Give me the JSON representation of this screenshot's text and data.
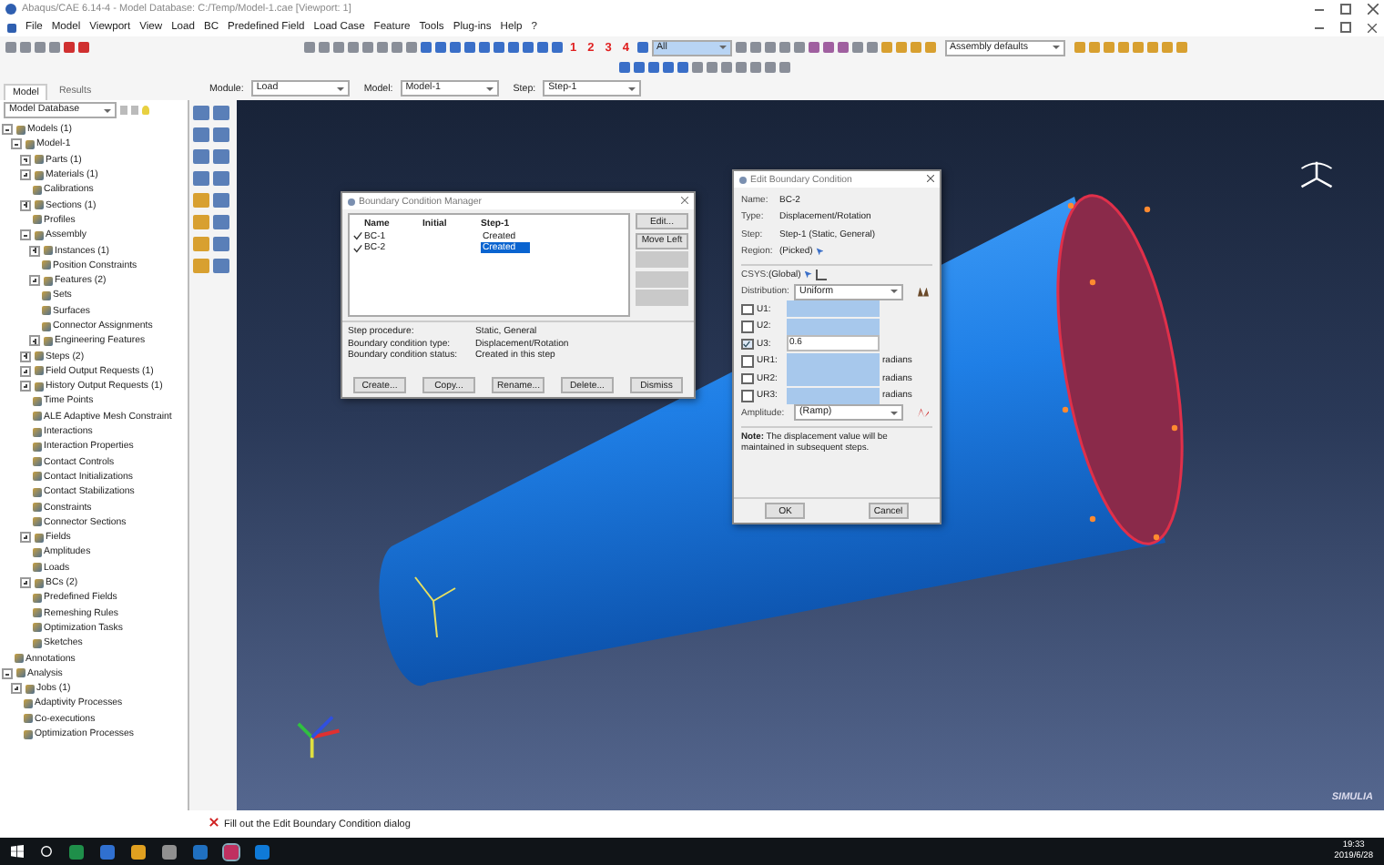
{
  "window": {
    "title": "Abaqus/CAE 6.14-4 - Model Database: C:/Temp/Model-1.cae [Viewport: 1]"
  },
  "menu": [
    "File",
    "Model",
    "Viewport",
    "View",
    "Load",
    "BC",
    "Predefined Field",
    "Load Case",
    "Feature",
    "Tools",
    "Plug-ins",
    "Help",
    "?"
  ],
  "toolbar": {
    "view_numbers": [
      "1",
      "2",
      "3",
      "4"
    ],
    "selection_filter": "All",
    "render_style": "Assembly defaults"
  },
  "context_bar": {
    "tabs": [
      {
        "label": "Model",
        "selected": true
      },
      {
        "label": "Results",
        "selected": false
      }
    ],
    "fields": [
      {
        "label": "Module:",
        "value": "Load"
      },
      {
        "label": "Model:",
        "value": "Model-1"
      },
      {
        "label": "Step:",
        "value": "Step-1"
      }
    ]
  },
  "tree": {
    "source": "Model Database",
    "items": [
      {
        "label": "Models (1)",
        "expander": true,
        "expanded": true,
        "children": [
          {
            "label": "Model-1",
            "expander": true,
            "expanded": true,
            "children": [
              {
                "label": "Parts (1)",
                "expander": true,
                "expanded": false
              },
              {
                "label": "Materials (1)",
                "expander": true,
                "expanded": false
              },
              {
                "label": "Calibrations",
                "expander": false,
                "expanded": false
              },
              {
                "label": "Sections (1)",
                "expander": true,
                "expanded": false
              },
              {
                "label": "Profiles",
                "expander": false,
                "expanded": false
              },
              {
                "label": "Assembly",
                "expander": true,
                "expanded": true,
                "children": [
                  {
                    "label": "Instances (1)",
                    "expander": true,
                    "expanded": false
                  },
                  {
                    "label": "Position Constraints",
                    "expander": false,
                    "expanded": false
                  },
                  {
                    "label": "Features (2)",
                    "expander": true,
                    "expanded": false
                  },
                  {
                    "label": "Sets",
                    "expander": false,
                    "expanded": false
                  },
                  {
                    "label": "Surfaces",
                    "expander": false,
                    "expanded": false
                  },
                  {
                    "label": "Connector Assignments",
                    "expander": false,
                    "expanded": false
                  },
                  {
                    "label": "Engineering Features",
                    "expander": true,
                    "expanded": false
                  }
                ]
              },
              {
                "label": "Steps (2)",
                "expander": true,
                "expanded": false
              },
              {
                "label": "Field Output Requests (1)",
                "expander": true,
                "expanded": false
              },
              {
                "label": "History Output Requests (1)",
                "expander": true,
                "expanded": false
              },
              {
                "label": "Time Points",
                "expander": false,
                "expanded": false
              },
              {
                "label": "ALE Adaptive Mesh Constraint",
                "expander": false,
                "expanded": false
              },
              {
                "label": "Interactions",
                "expander": false,
                "expanded": false
              },
              {
                "label": "Interaction Properties",
                "expander": false,
                "expanded": false
              },
              {
                "label": "Contact Controls",
                "expander": false,
                "expanded": false
              },
              {
                "label": "Contact Initializations",
                "expander": false,
                "expanded": false
              },
              {
                "label": "Contact Stabilizations",
                "expander": false,
                "expanded": false
              },
              {
                "label": "Constraints",
                "expander": false,
                "expanded": false
              },
              {
                "label": "Connector Sections",
                "expander": false,
                "expanded": false
              },
              {
                "label": "Fields",
                "expander": true,
                "expanded": false
              },
              {
                "label": "Amplitudes",
                "expander": false,
                "expanded": false
              },
              {
                "label": "Loads",
                "expander": false,
                "expanded": false
              },
              {
                "label": "BCs (2)",
                "expander": true,
                "expanded": false
              },
              {
                "label": "Predefined Fields",
                "expander": false,
                "expanded": false
              },
              {
                "label": "Remeshing Rules",
                "expander": false,
                "expanded": false
              },
              {
                "label": "Optimization Tasks",
                "expander": false,
                "expanded": false
              },
              {
                "label": "Sketches",
                "expander": false,
                "expanded": false
              }
            ]
          }
        ]
      },
      {
        "label": "Annotations",
        "expander": false,
        "expanded": false
      },
      {
        "label": "Analysis",
        "expander": true,
        "expanded": true,
        "children": [
          {
            "label": "Jobs (1)",
            "expander": true,
            "expanded": false
          },
          {
            "label": "Adaptivity Processes",
            "expander": false,
            "expanded": false
          },
          {
            "label": "Co-executions",
            "expander": false,
            "expanded": false
          },
          {
            "label": "Optimization Processes",
            "expander": false,
            "expanded": false
          }
        ]
      }
    ]
  },
  "bc_manager": {
    "title": "Boundary Condition Manager",
    "columns": [
      "Name",
      "Initial",
      "Step-1"
    ],
    "rows": [
      {
        "name": "BC-1",
        "active": true,
        "step_1": "Created",
        "selected": false
      },
      {
        "name": "BC-2",
        "active": true,
        "step_1": "Created",
        "selected": true
      }
    ],
    "side_buttons": [
      {
        "label": "Edit...",
        "disabled": false
      },
      {
        "label": "Move Left",
        "disabled": false
      },
      {
        "disabled": true
      },
      {
        "disabled": true
      },
      {
        "disabled": true
      }
    ],
    "info": [
      {
        "label": "Step procedure:",
        "value": "Static, General"
      },
      {
        "label": "Boundary condition type:",
        "value": "Displacement/Rotation"
      },
      {
        "label": "Boundary condition status:",
        "value": "Created in this step"
      }
    ],
    "buttons": [
      "Create...",
      "Copy...",
      "Rename...",
      "Delete...",
      "Dismiss"
    ]
  },
  "edit_bc": {
    "title": "Edit Boundary Condition",
    "info": [
      {
        "label": "Name:",
        "value": "BC-2"
      },
      {
        "label": "Type:",
        "value": "Displacement/Rotation"
      },
      {
        "label": "Step:",
        "value": "Step-1 (Static, General)"
      },
      {
        "label": "Region:",
        "value": "(Picked)"
      }
    ],
    "csys": {
      "label": "CSYS:",
      "value": "(Global)"
    },
    "distribution": {
      "label": "Distribution:",
      "value": "Uniform"
    },
    "dofs": [
      {
        "label": "U1:",
        "checked": false
      },
      {
        "label": "U2:",
        "checked": false
      },
      {
        "label": "U3:",
        "checked": true,
        "value": "0.6"
      },
      {
        "label": "UR1:",
        "checked": false,
        "unit": "radians"
      },
      {
        "label": "UR2:",
        "checked": false,
        "unit": "radians"
      },
      {
        "label": "UR3:",
        "checked": false,
        "unit": "radians"
      }
    ],
    "amplitude": {
      "label": "Amplitude:",
      "value": "(Ramp)"
    },
    "note": "**Note:** The displacement value will be maintained in subsequent steps.",
    "buttons": [
      "OK",
      "Cancel"
    ]
  },
  "message": "Fill out the Edit Boundary Condition dialog",
  "logo": "SIMULIA",
  "taskbar": {
    "time": "19:33",
    "date": "2019/6/28"
  }
}
